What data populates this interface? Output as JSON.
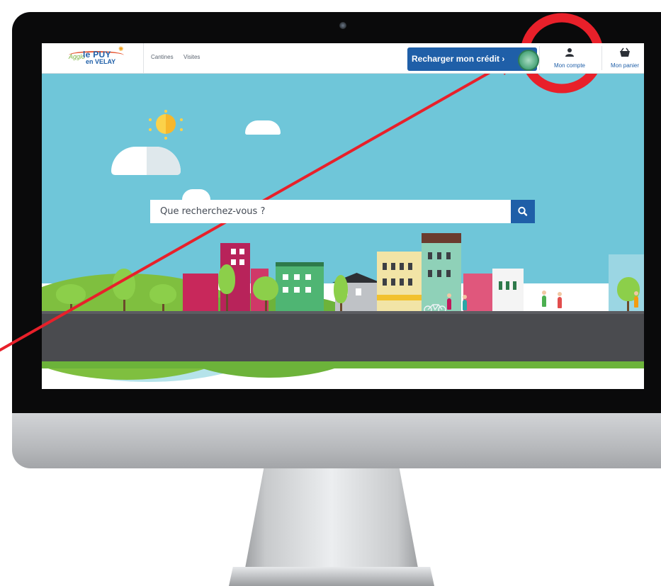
{
  "header": {
    "logo": {
      "script": "Agglo",
      "puy": "le PUY",
      "velay": "en VELAY"
    },
    "nav_links": [
      {
        "label": "Cantines"
      },
      {
        "label": "Visites"
      }
    ],
    "recharge_button": {
      "label": "Recharger mon crédit"
    },
    "account_button": {
      "label": "Mon compte",
      "icon": "person-icon"
    },
    "cart_button": {
      "label": "Mon panier",
      "icon": "basket-icon"
    }
  },
  "search": {
    "placeholder": "Que recherchez-vous ?",
    "value": "",
    "icon": "search-icon"
  },
  "colors": {
    "brand_blue": "#1f5fa8",
    "sky": "#6fc6d9",
    "annotation_red": "#e8202a"
  }
}
